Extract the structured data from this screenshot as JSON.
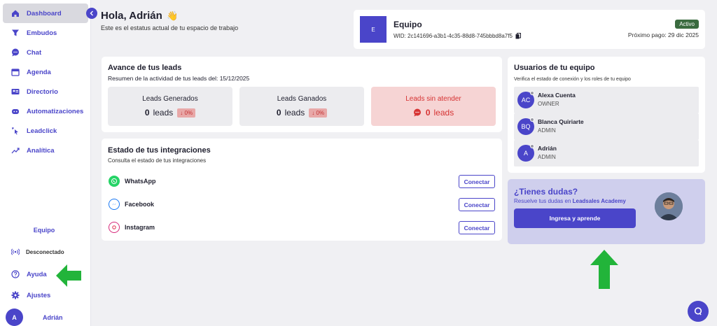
{
  "sidebar": {
    "items": [
      {
        "label": "Dashboard",
        "icon": "home-icon",
        "active": true
      },
      {
        "label": "Embudos",
        "icon": "funnel-icon"
      },
      {
        "label": "Chat",
        "icon": "chat-icon"
      },
      {
        "label": "Agenda",
        "icon": "calendar-icon"
      },
      {
        "label": "Directorio",
        "icon": "contacts-icon"
      },
      {
        "label": "Automatizaciones",
        "icon": "bot-icon"
      },
      {
        "label": "Leadclick",
        "icon": "click-icon"
      },
      {
        "label": "Analítica",
        "icon": "trend-icon"
      }
    ],
    "team_label": "Equipo",
    "status": "Desconectado",
    "help": "Ayuda",
    "settings": "Ajustes",
    "user_initial": "A",
    "user_name": "Adrián"
  },
  "header": {
    "greeting": "Hola, Adrián",
    "wave": "👋",
    "subtitle": "Este es el estatus actual de tu espacio de trabajo"
  },
  "team_card": {
    "initial": "E",
    "name": "Equipo",
    "wid": "WID: 2c141696-a3b1-4c35-88d8-745bbbd8a7f5",
    "status": "Activo",
    "next_payment": "Próximo pago: 29 dic 2025"
  },
  "leads": {
    "title": "Avance de tus leads",
    "subtitle": "Resumen de la actividad de tus leads del: 15/12/2025",
    "boxes": [
      {
        "label": "Leads Generados",
        "value": "0",
        "unit": "leads",
        "pct": "↓ 0%"
      },
      {
        "label": "Leads Ganados",
        "value": "0",
        "unit": "leads",
        "pct": "↓ 0%"
      },
      {
        "label": "Leads sin atender",
        "value": "0",
        "unit": "leads"
      }
    ]
  },
  "integrations": {
    "title": "Estado de tus integraciones",
    "subtitle": "Consulta el estado de tus integraciones",
    "items": [
      {
        "name": "WhatsApp",
        "button": "Conectar",
        "color": "#25d366"
      },
      {
        "name": "Facebook",
        "button": "Conectar",
        "color": "#1877f2"
      },
      {
        "name": "Instagram",
        "button": "Conectar",
        "color": "#d6287a"
      }
    ]
  },
  "team_users": {
    "title": "Usuarios de tu equipo",
    "subtitle": "Verifica el estado de conexión y los roles de tu equipo",
    "members": [
      {
        "initials": "AC",
        "name": "Alexa Cuenta",
        "role": "OWNER"
      },
      {
        "initials": "BQ",
        "name": "Blanca Quiriarte",
        "role": "ADMIN"
      },
      {
        "initials": "A",
        "name": "Adrián",
        "role": "ADMIN"
      }
    ]
  },
  "help_card": {
    "title": "¿Tienes dudas?",
    "subtitle_prefix": "Resuelve tus dudas en",
    "subtitle_link": "Leadsales Academy",
    "button": "Ingresa y aprende"
  },
  "colors": {
    "brand": "#4a45c9",
    "alert": "#d63333",
    "active_badge": "#3a6b3f",
    "arrow": "#22b43a"
  }
}
